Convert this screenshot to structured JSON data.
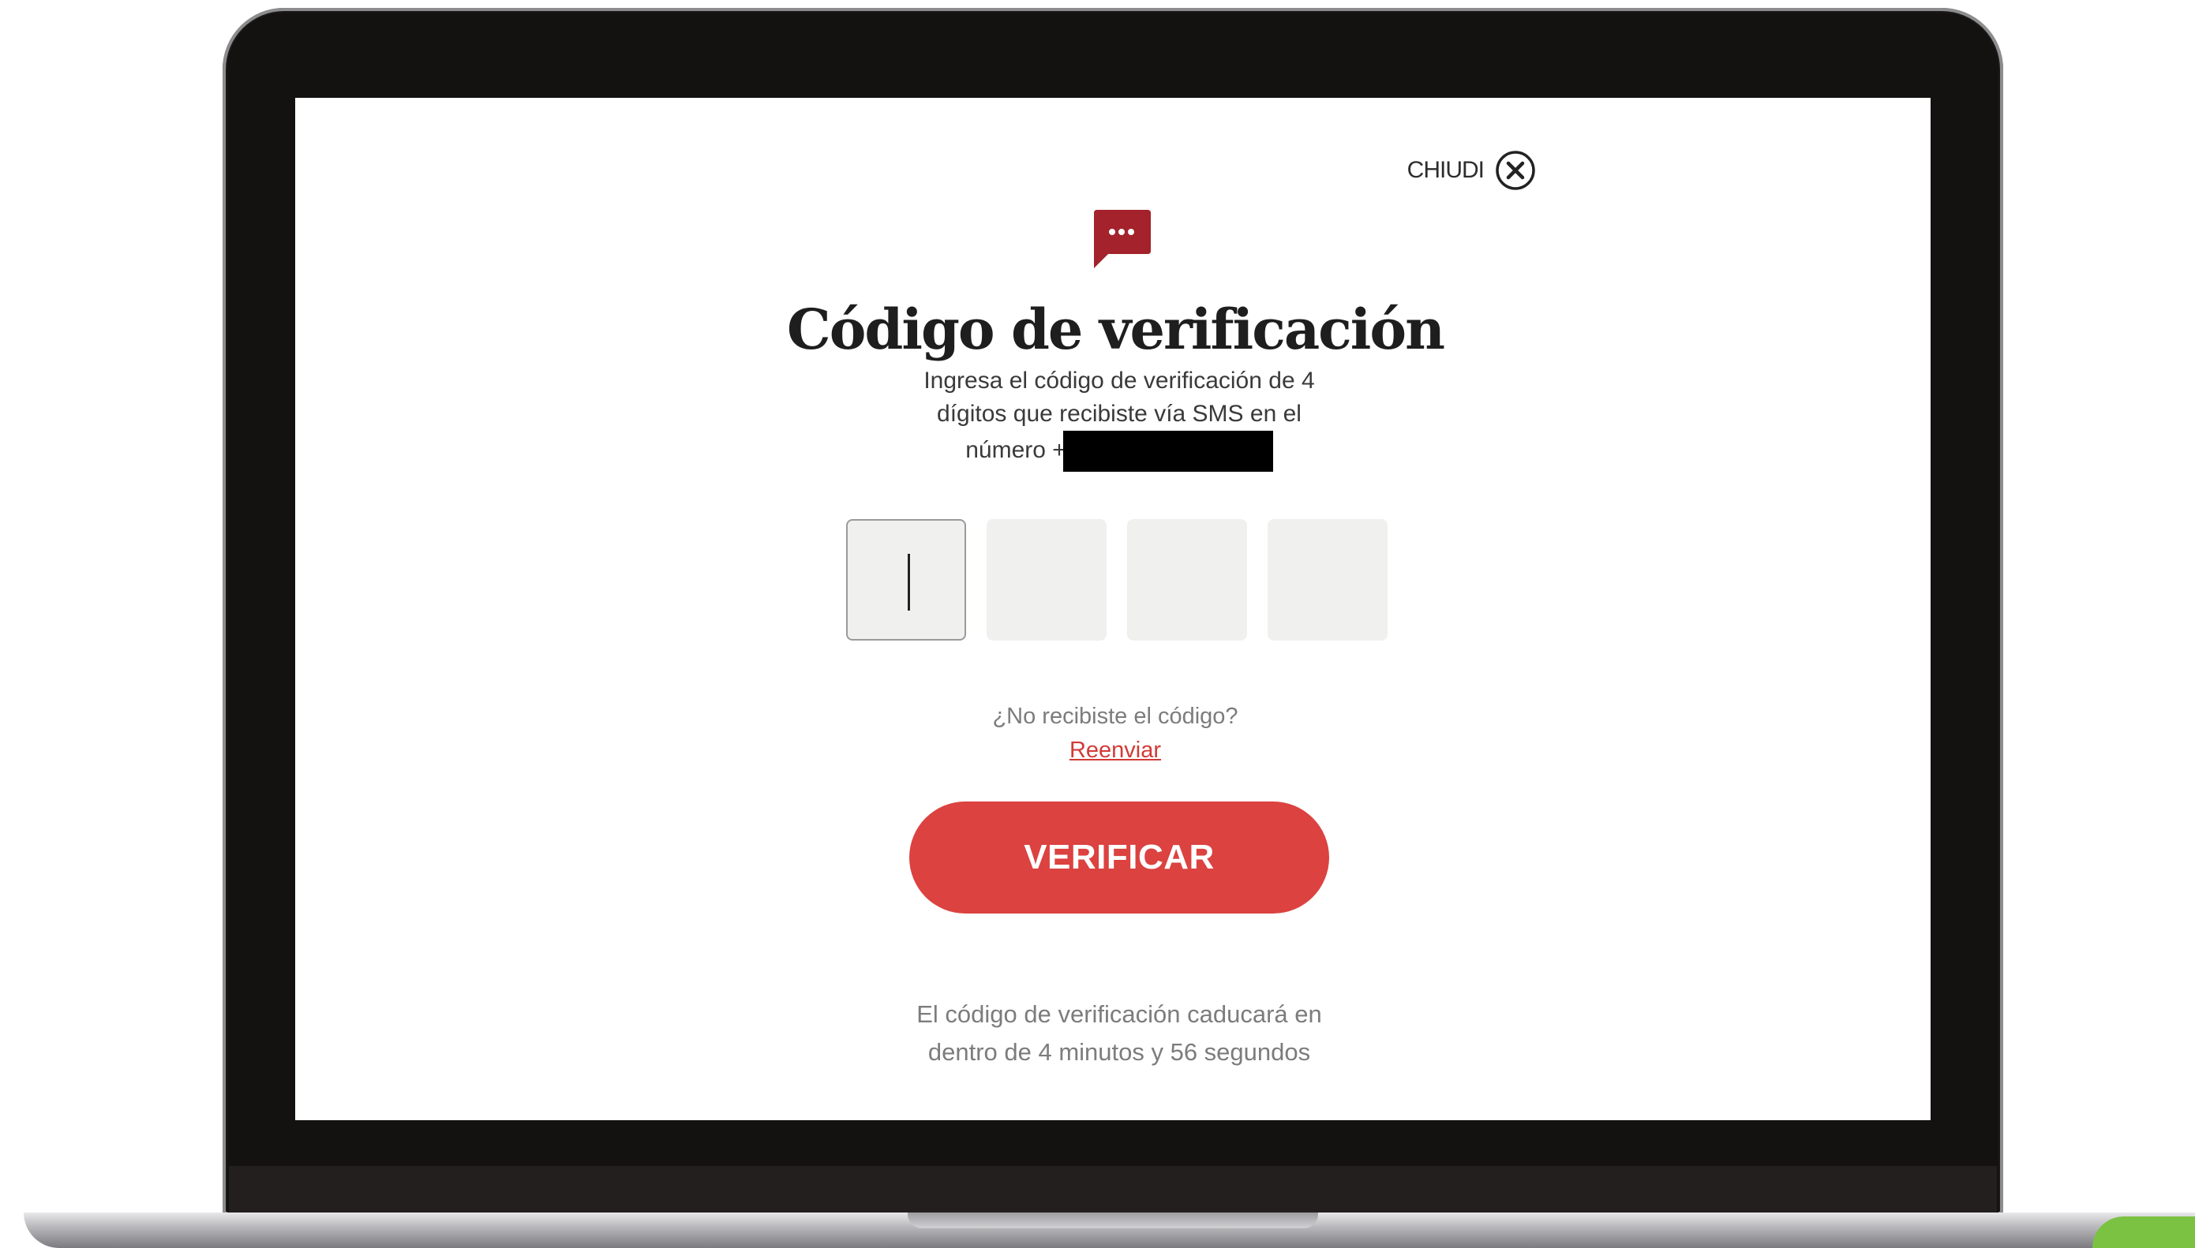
{
  "dialog": {
    "close_label": "CHIUDI",
    "close_icon": "close-circle-icon",
    "header_icon": "chat-bubble-icon",
    "title": "Código de verificación",
    "description_line1": "Ingresa el código de verificación de 4",
    "description_line2": "dígitos que recibiste vía SMS en el",
    "description_line3": "número +",
    "code_inputs": [
      "",
      "",
      "",
      ""
    ],
    "resend_prompt": "¿No recibiste el código?",
    "resend_link": "Reenviar",
    "verify_button": "VERIFICAR",
    "expiry_line1": "El código de verificación caducará en",
    "expiry_line2": "dentro de 4 minutos y 56 segundos"
  },
  "colors": {
    "accent": "#db4240",
    "icon": "#a3222b",
    "link": "#d23b36",
    "input_bg": "#f0f0ee"
  }
}
